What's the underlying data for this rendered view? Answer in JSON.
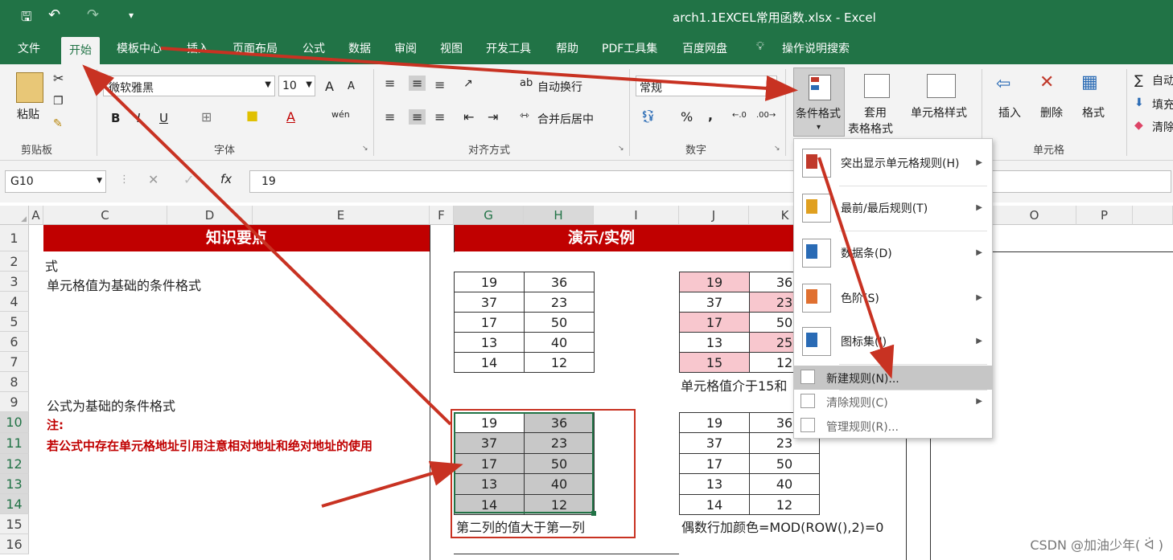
{
  "window": {
    "title": "arch1.1EXCEL常用函数.xlsx  -  Excel"
  },
  "tabs": [
    "文件",
    "开始",
    "模板中心",
    "插入",
    "页面布局",
    "公式",
    "数据",
    "审阅",
    "视图",
    "开发工具",
    "帮助",
    "PDF工具集",
    "百度网盘",
    "操作说明搜索"
  ],
  "ribbon": {
    "clipboard": {
      "paste": "粘贴",
      "group": "剪贴板"
    },
    "font": {
      "name": "微软雅黑",
      "size": "10",
      "group": "字体",
      "bold": "B",
      "italic": "I",
      "underline": "U",
      "grow": "A",
      "shrink": "A",
      "wen": "wén"
    },
    "align": {
      "wrap": "自动换行",
      "merge": "合并后居中",
      "group": "对齐方式"
    },
    "number": {
      "format": "常规",
      "group": "数字",
      "percent": "%",
      "comma": ","
    },
    "styles": {
      "cond": "条件格式",
      "table1": "套用",
      "table2": "表格格式",
      "cellstyle": "单元格样式"
    },
    "cells": {
      "insert": "插入",
      "delete": "删除",
      "format": "格式",
      "group": "单元格"
    },
    "edit": {
      "sum": "自动",
      "fill": "填充",
      "clear": "清除"
    }
  },
  "formula": {
    "namebox": "G10",
    "fx": "fx",
    "value": "19"
  },
  "columns": [
    "A",
    "C",
    "D",
    "E",
    "F",
    "G",
    "H",
    "I",
    "J",
    "K",
    "O",
    "P"
  ],
  "rows": [
    "1",
    "2",
    "3",
    "4",
    "5",
    "6",
    "7",
    "8",
    "9",
    "10",
    "11",
    "12",
    "13",
    "14",
    "15",
    "16"
  ],
  "headers": {
    "left": "知识要点",
    "right": "演示/实例"
  },
  "text": {
    "r2": "式",
    "r3": "单元格值为基础的条件格式",
    "r9": "公式为基础的条件格式",
    "r10": "注:",
    "r11": "若公式中存在单元格地址引用注意相对地址和绝对地址的使用",
    "r8j": "单元格值介于15和",
    "r15g": "第二列的值大于第一列",
    "r15j": "偶数行加颜色=MOD(ROW(),2)=0"
  },
  "table1": [
    [
      "19",
      "36"
    ],
    [
      "37",
      "23"
    ],
    [
      "17",
      "50"
    ],
    [
      "13",
      "40"
    ],
    [
      "14",
      "12"
    ]
  ],
  "table2": [
    [
      "19",
      "36"
    ],
    [
      "37",
      "23"
    ],
    [
      "17",
      "50"
    ],
    [
      "13",
      "25"
    ],
    [
      "15",
      "12"
    ]
  ],
  "table3": [
    [
      "19",
      "36"
    ],
    [
      "37",
      "23"
    ],
    [
      "17",
      "50"
    ],
    [
      "13",
      "40"
    ],
    [
      "14",
      "12"
    ]
  ],
  "table4": [
    [
      "19",
      "36"
    ],
    [
      "37",
      "23"
    ],
    [
      "17",
      "50"
    ],
    [
      "13",
      "40"
    ],
    [
      "14",
      "12"
    ]
  ],
  "menu": [
    {
      "label": "突出显示单元格规则(H)",
      "sub": true
    },
    {
      "label": "最前/最后规则(T)",
      "sub": true
    },
    {
      "label": "数据条(D)",
      "sub": true
    },
    {
      "label": "色阶(S)",
      "sub": true
    },
    {
      "label": "图标集(I)",
      "sub": true
    },
    {
      "label": "新建规则(N)...",
      "sub": false
    },
    {
      "label": "清除规则(C)",
      "sub": true
    },
    {
      "label": "管理规则(R)..."
    }
  ],
  "watermark": "CSDN @加油少年( ᐛ )",
  "colors": {
    "excel_green": "#217346",
    "header_red": "#c00000",
    "highlight_pink": "#f8c7ce",
    "selection_gray": "#c8c8c8"
  }
}
